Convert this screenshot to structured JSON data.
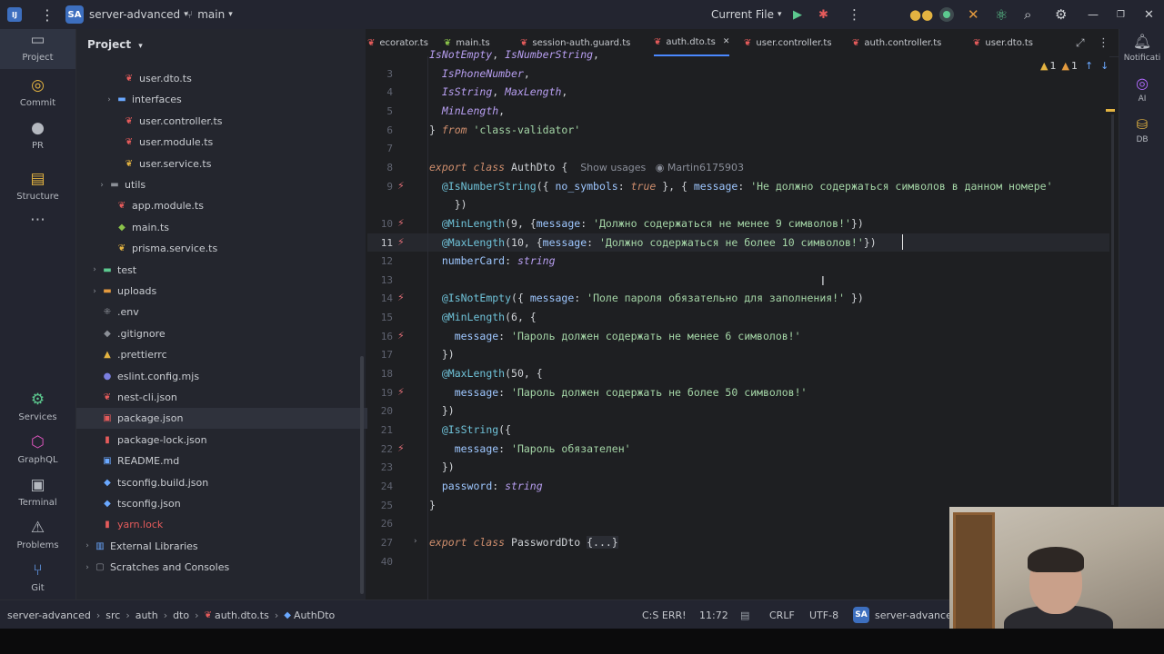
{
  "titlebar": {
    "project_badge": "SA",
    "project_name": "server-advanced",
    "branch": "main",
    "run_config": "Current File"
  },
  "activity": {
    "items": [
      {
        "label": "Project"
      },
      {
        "label": "Commit"
      },
      {
        "label": "PR"
      },
      {
        "label": "Structure"
      },
      {
        "label": "Services"
      },
      {
        "label": "GraphQL"
      },
      {
        "label": "Terminal"
      },
      {
        "label": "Problems"
      },
      {
        "label": "Git"
      }
    ]
  },
  "project_panel": {
    "title": "Project",
    "tree": [
      {
        "label": "user.dto.ts",
        "indent": 4,
        "chev": "",
        "icon": "nest",
        "color": "#e55b5b"
      },
      {
        "label": "interfaces",
        "indent": 3,
        "chev": "›",
        "icon": "folder",
        "color": "#6aa8ff"
      },
      {
        "label": "user.controller.ts",
        "indent": 4,
        "chev": "",
        "icon": "nest",
        "color": "#e55b5b"
      },
      {
        "label": "user.module.ts",
        "indent": 4,
        "chev": "",
        "icon": "nest",
        "color": "#e55b5b"
      },
      {
        "label": "user.service.ts",
        "indent": 4,
        "chev": "",
        "icon": "nest",
        "color": "#e3b341"
      },
      {
        "label": "utils",
        "indent": 2,
        "chev": "›",
        "icon": "folder",
        "color": "#8b8f97"
      },
      {
        "label": "app.module.ts",
        "indent": 3,
        "chev": "",
        "icon": "nest",
        "color": "#e55b5b"
      },
      {
        "label": "main.ts",
        "indent": 3,
        "chev": "",
        "icon": "ts",
        "color": "#8bc34a"
      },
      {
        "label": "prisma.service.ts",
        "indent": 3,
        "chev": "",
        "icon": "nest",
        "color": "#e3b341"
      },
      {
        "label": "test",
        "indent": 1,
        "chev": "›",
        "icon": "folder",
        "color": "#5cc98f"
      },
      {
        "label": "uploads",
        "indent": 1,
        "chev": "›",
        "icon": "folder",
        "color": "#e39a3e"
      },
      {
        "label": ".env",
        "indent": 1,
        "chev": "",
        "icon": "env",
        "color": "#8b8f97"
      },
      {
        "label": ".gitignore",
        "indent": 1,
        "chev": "",
        "icon": "git",
        "color": "#8b8f97"
      },
      {
        "label": ".prettierrc",
        "indent": 1,
        "chev": "",
        "icon": "prettier",
        "color": "#e3b341"
      },
      {
        "label": "eslint.config.mjs",
        "indent": 1,
        "chev": "",
        "icon": "eslint",
        "color": "#7b7fe0"
      },
      {
        "label": "nest-cli.json",
        "indent": 1,
        "chev": "",
        "icon": "nest",
        "color": "#e55b5b"
      },
      {
        "label": "package.json",
        "indent": 1,
        "chev": "",
        "icon": "npm",
        "color": "#e55b5b",
        "selected": true
      },
      {
        "label": "package-lock.json",
        "indent": 1,
        "chev": "",
        "icon": "lock",
        "color": "#e55b5b"
      },
      {
        "label": "README.md",
        "indent": 1,
        "chev": "",
        "icon": "md",
        "color": "#6aa8ff"
      },
      {
        "label": "tsconfig.build.json",
        "indent": 1,
        "chev": "",
        "icon": "ts",
        "color": "#6aa8ff"
      },
      {
        "label": "tsconfig.json",
        "indent": 1,
        "chev": "",
        "icon": "ts",
        "color": "#6aa8ff"
      },
      {
        "label": "yarn.lock",
        "indent": 1,
        "chev": "",
        "icon": "lock",
        "color": "#e55b5b",
        "red": true
      },
      {
        "label": "External Libraries",
        "indent": 0,
        "chev": "›",
        "icon": "lib",
        "color": "#6aa8ff"
      },
      {
        "label": "Scratches and Consoles",
        "indent": 0,
        "chev": "›",
        "icon": "scratch",
        "color": "#8b8f97"
      }
    ]
  },
  "tabs": [
    {
      "label": "ecorator.ts",
      "color": "#e55b5b"
    },
    {
      "label": "main.ts",
      "color": "#8bc34a"
    },
    {
      "label": "session-auth.guard.ts",
      "color": "#e55b5b"
    },
    {
      "label": "auth.dto.ts",
      "color": "#e55b5b",
      "active": true
    },
    {
      "label": "user.controller.ts",
      "color": "#e55b5b"
    },
    {
      "label": "auth.controller.ts",
      "color": "#e55b5b"
    },
    {
      "label": "user.dto.ts",
      "color": "#e55b5b"
    }
  ],
  "editor": {
    "current_line": 11,
    "problems": {
      "warnings": "1",
      "errors": "1"
    },
    "lines": [
      {
        "n": "",
        "html": "<span class=\"it\">IsNotEmpty</span>, <span class=\"it\">IsNumberString</span>,"
      },
      {
        "n": "3",
        "html": "  <span class=\"it\">IsPhoneNumber</span>,"
      },
      {
        "n": "4",
        "html": "  <span class=\"it\">IsString</span>, <span class=\"it\">MaxLength</span>,"
      },
      {
        "n": "5",
        "html": "  <span class=\"it\">MinLength</span>,"
      },
      {
        "n": "6",
        "html": "} <span class=\"kw\">from</span> <span class=\"str\">'class-validator'</span>"
      },
      {
        "n": "7",
        "html": ""
      },
      {
        "n": "8",
        "html": "<span class=\"kw\">export class</span> AuthDto {  <span class=\"hint\">Show usages   ◉ Martin6175903</span>"
      },
      {
        "n": "9",
        "html": "  <span class=\"dec\">@IsNumberString</span>({ <span class=\"prop\">no_symbols</span>: <span class=\"bool\">true</span> }, { <span class=\"prop\">message</span>: <span class=\"str\">'Не должно содержаться символов в данном номере'</span>"
      },
      {
        "n": "",
        "html": "    })"
      },
      {
        "n": "10",
        "html": "  <span class=\"dec\">@MinLength</span>(9, {<span class=\"prop\">message</span>: <span class=\"str\">'Должно содержаться не менее 9 символов!'</span>})"
      },
      {
        "n": "11",
        "html": "  <span class=\"dec\">@MaxLength</span>(10, {<span class=\"prop\">message</span>: <span class=\"str\">'Должно содержаться не более 10 символов!'</span>})"
      },
      {
        "n": "12",
        "html": "  <span class=\"prop\">numberCard</span>: <span class=\"typ\">string</span>"
      },
      {
        "n": "13",
        "html": ""
      },
      {
        "n": "14",
        "html": "  <span class=\"dec\">@IsNotEmpty</span>({ <span class=\"prop\">message</span>: <span class=\"str\">'Поле пароля обязательно для заполнения!'</span> })"
      },
      {
        "n": "15",
        "html": "  <span class=\"dec\">@MinLength</span>(6, {"
      },
      {
        "n": "16",
        "html": "    <span class=\"prop\">message</span>: <span class=\"str\">'Пароль должен содержать не менее 6 символов!'</span>"
      },
      {
        "n": "17",
        "html": "  })"
      },
      {
        "n": "18",
        "html": "  <span class=\"dec\">@MaxLength</span>(50, {"
      },
      {
        "n": "19",
        "html": "    <span class=\"prop\">message</span>: <span class=\"str\">'Пароль должен содержать не более 50 символов!'</span>"
      },
      {
        "n": "20",
        "html": "  })"
      },
      {
        "n": "21",
        "html": "  <span class=\"dec\">@IsString</span>({"
      },
      {
        "n": "22",
        "html": "    <span class=\"prop\">message</span>: <span class=\"str\">'Пароль обязателен'</span>"
      },
      {
        "n": "23",
        "html": "  })"
      },
      {
        "n": "24",
        "html": "  <span class=\"prop\">password</span>: <span class=\"typ\">string</span>"
      },
      {
        "n": "25",
        "html": "}"
      },
      {
        "n": "26",
        "html": ""
      },
      {
        "n": "27",
        "html": "<span class=\"kw\">export class</span> PasswordDto <span style=\"background:#2b2d34\">{...}</span>"
      },
      {
        "n": "40",
        "html": ""
      }
    ],
    "gutter_icons": [
      "9",
      "10",
      "11",
      "14",
      "16",
      "19",
      "22"
    ]
  },
  "right_toolbar": [
    {
      "label": "Notificati"
    },
    {
      "label": "AI"
    },
    {
      "label": "DB"
    }
  ],
  "statusbar": {
    "breadcrumb": [
      "server-advanced",
      "src",
      "auth",
      "dto",
      "auth.dto.ts",
      "AuthDto"
    ],
    "inspection": "C:S ERR!",
    "position": "11:72",
    "line_sep": "CRLF",
    "encoding": "UTF-8",
    "project_badge": "SA",
    "project": "server-advanced"
  }
}
